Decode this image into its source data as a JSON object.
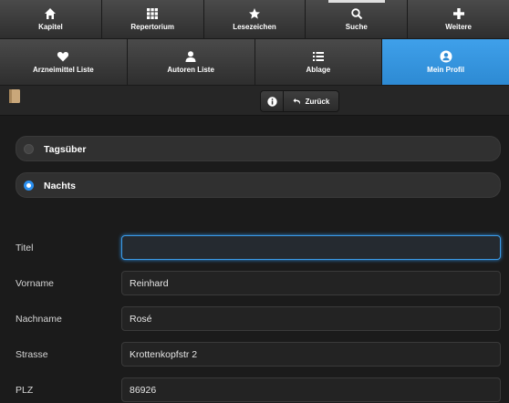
{
  "nav": {
    "row1": [
      {
        "label": "Kapitel",
        "icon": "home-icon"
      },
      {
        "label": "Repertorium",
        "icon": "grid-icon"
      },
      {
        "label": "Lesezeichen",
        "icon": "star-icon"
      },
      {
        "label": "Suche",
        "icon": "search-icon"
      },
      {
        "label": "Weitere",
        "icon": "plus-icon"
      }
    ],
    "row2": [
      {
        "label": "Arzneimittel Liste",
        "icon": "heart-icon"
      },
      {
        "label": "Autoren Liste",
        "icon": "user-icon"
      },
      {
        "label": "Ablage",
        "icon": "list-icon"
      },
      {
        "label": "Mein Profil",
        "icon": "user-circle-icon",
        "active": true
      }
    ]
  },
  "toolbar": {
    "back_label": "Zurück"
  },
  "options": [
    {
      "label": "Tagsüber",
      "selected": false
    },
    {
      "label": "Nachts",
      "selected": true
    }
  ],
  "form": {
    "titel_label": "Titel",
    "titel_value": "",
    "vorname_label": "Vorname",
    "vorname_value": "Reinhard",
    "nachname_label": "Nachname",
    "nachname_value": "Rosé",
    "strasse_label": "Strasse",
    "strasse_value": "Krottenkopfstr 2",
    "plz_label": "PLZ",
    "plz_value": "86926"
  },
  "colors": {
    "accent": "#2d8ad3",
    "background": "#1b1b1b"
  }
}
